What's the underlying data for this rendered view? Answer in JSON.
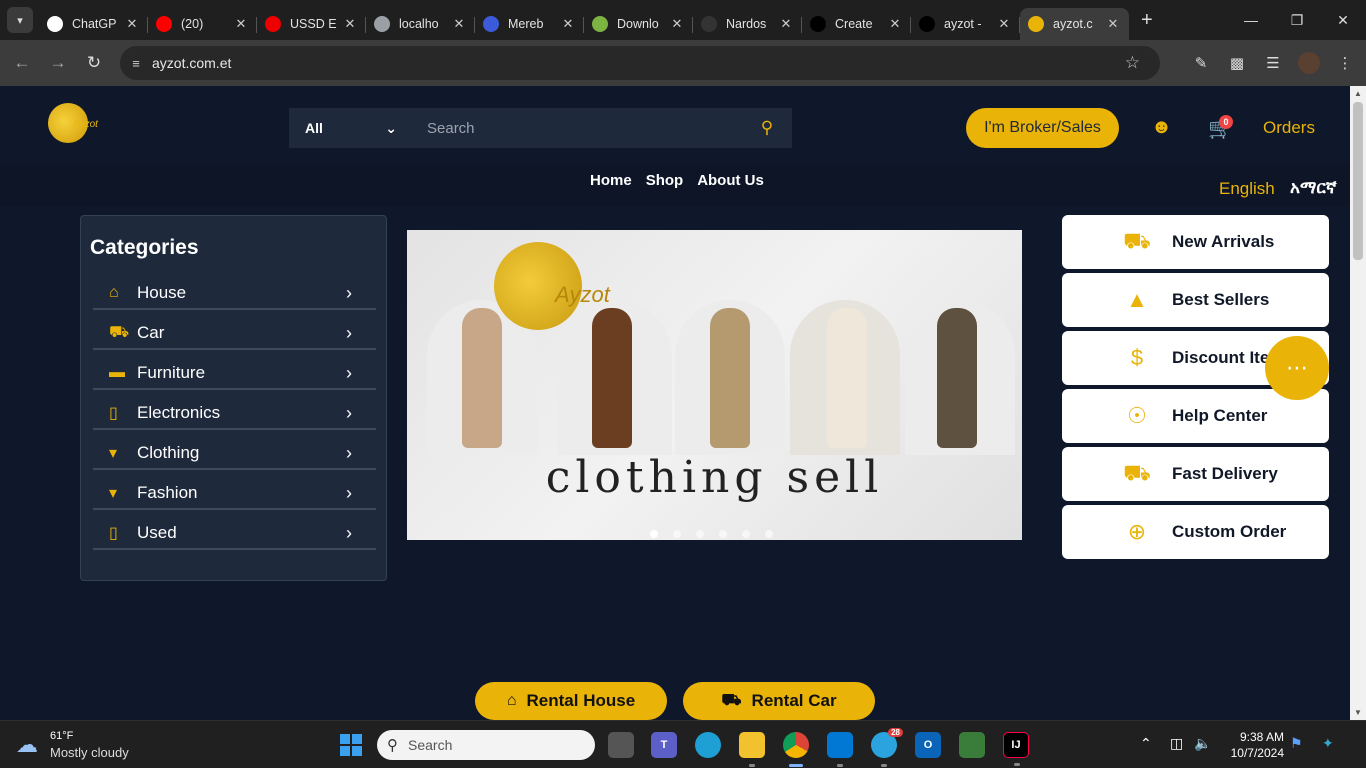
{
  "browser": {
    "tabs": [
      {
        "title": "ChatGP",
        "icon": "chatgpt-icon",
        "color": "#ffffff"
      },
      {
        "title": "(20)",
        "icon": "youtube-icon",
        "color": "#ff0000"
      },
      {
        "title": "USSD E",
        "icon": "redhat-icon",
        "color": "#ee0000"
      },
      {
        "title": "localho",
        "icon": "globe-icon",
        "color": "#9aa0a6"
      },
      {
        "title": "Mereb",
        "icon": "mereb-icon",
        "color": "#3b5bdb"
      },
      {
        "title": "Downlo",
        "icon": "download-icon",
        "color": "#7cb342"
      },
      {
        "title": "Nardos",
        "icon": "github-icon",
        "color": "#333333"
      },
      {
        "title": "Create",
        "icon": "vercel-icon",
        "color": "#000000"
      },
      {
        "title": "ayzot -",
        "icon": "vercel-icon",
        "color": "#000000"
      },
      {
        "title": "ayzot.c",
        "icon": "ayzot-icon",
        "color": "#eab308",
        "active": true
      }
    ],
    "url": "ayzot.com.et"
  },
  "header": {
    "logo_text": "Ayzot",
    "search": {
      "category": "All",
      "placeholder": "Search"
    },
    "broker_button": "I'm Broker/Sales",
    "cart_count": "0",
    "orders": "Orders"
  },
  "nav": {
    "links": [
      "Home",
      "Shop",
      "About Us"
    ],
    "lang_en": "English",
    "lang_am": "አማርኛ"
  },
  "categories": {
    "title": "Categories",
    "items": [
      {
        "label": "House",
        "icon": "home-icon"
      },
      {
        "label": "Car",
        "icon": "car-icon"
      },
      {
        "label": "Furniture",
        "icon": "couch-icon"
      },
      {
        "label": "Electronics",
        "icon": "mobile-icon"
      },
      {
        "label": "Clothing",
        "icon": "shirt-icon"
      },
      {
        "label": "Fashion",
        "icon": "shirt-icon"
      },
      {
        "label": "Used",
        "icon": "mobile-icon"
      }
    ]
  },
  "banner": {
    "logo_text": "Ayzot",
    "caption": "clothing sell",
    "slide_count": 6,
    "active_slide": 0
  },
  "services": [
    {
      "label": "New Arrivals",
      "icon": "car-icon"
    },
    {
      "label": "Best Sellers",
      "icon": "shopify-icon"
    },
    {
      "label": "Discount Item",
      "icon": "dollar-icon"
    },
    {
      "label": "Help Center",
      "icon": "headset-icon"
    },
    {
      "label": "Fast Delivery",
      "icon": "truck-icon"
    },
    {
      "label": "Custom Order",
      "icon": "cart-plus-icon"
    }
  ],
  "rentals": [
    {
      "label": "Rental House",
      "icon": "home-icon"
    },
    {
      "label": "Rental Car",
      "icon": "car-icon"
    }
  ],
  "taskbar": {
    "weather_temp": "61°F",
    "weather_cond": "Mostly cloudy",
    "search_placeholder": "Search",
    "telegram_badge": "28",
    "time": "9:38 AM",
    "date": "10/7/2024"
  },
  "colors": {
    "accent": "#eab308",
    "page_bg": "#0f172a",
    "panel_bg": "#1e293b"
  }
}
